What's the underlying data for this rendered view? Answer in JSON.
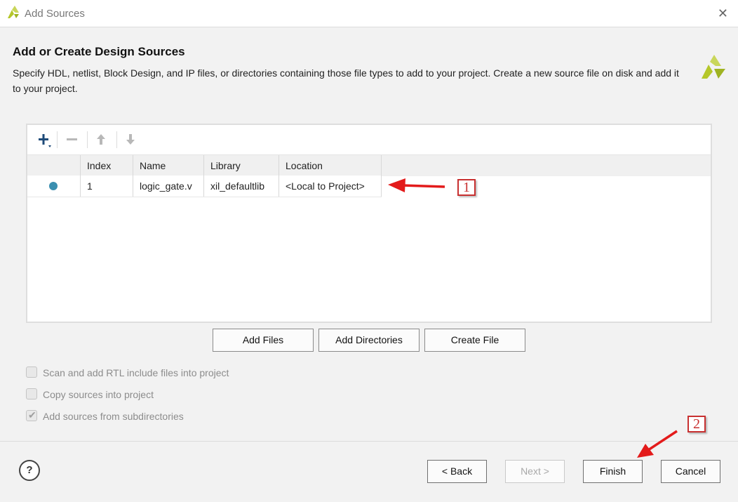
{
  "window": {
    "title": "Add Sources"
  },
  "header": {
    "title": "Add or Create Design Sources",
    "description": "Specify HDL, netlist, Block Design, and IP files, or directories containing those file types to add to your project. Create a new source file on disk and add it to your project."
  },
  "table": {
    "columns": [
      "",
      "Index",
      "Name",
      "Library",
      "Location"
    ],
    "rows": [
      {
        "index": "1",
        "name": "logic_gate.v",
        "library": "xil_defaultlib",
        "location": "<Local to Project>"
      }
    ]
  },
  "actions": {
    "add_files": "Add Files",
    "add_directories": "Add Directories",
    "create_file": "Create File"
  },
  "options": [
    {
      "label": "Scan and add RTL include files into project",
      "checked": false
    },
    {
      "label": "Copy sources into project",
      "checked": false
    },
    {
      "label": "Add sources from subdirectories",
      "checked": true
    }
  ],
  "footer": {
    "help": "?",
    "back": "< Back",
    "next": "Next >",
    "finish": "Finish",
    "cancel": "Cancel"
  },
  "annotations": {
    "one": "1",
    "two": "2"
  },
  "colors": {
    "accent_dot": "#3a8fb0",
    "annotation_red": "#c83030",
    "logo_green": "#b5c72a"
  },
  "icons": [
    "vivado-logo-icon",
    "close-icon",
    "plus-icon",
    "minus-icon",
    "arrow-up-icon",
    "arrow-down-icon"
  ]
}
